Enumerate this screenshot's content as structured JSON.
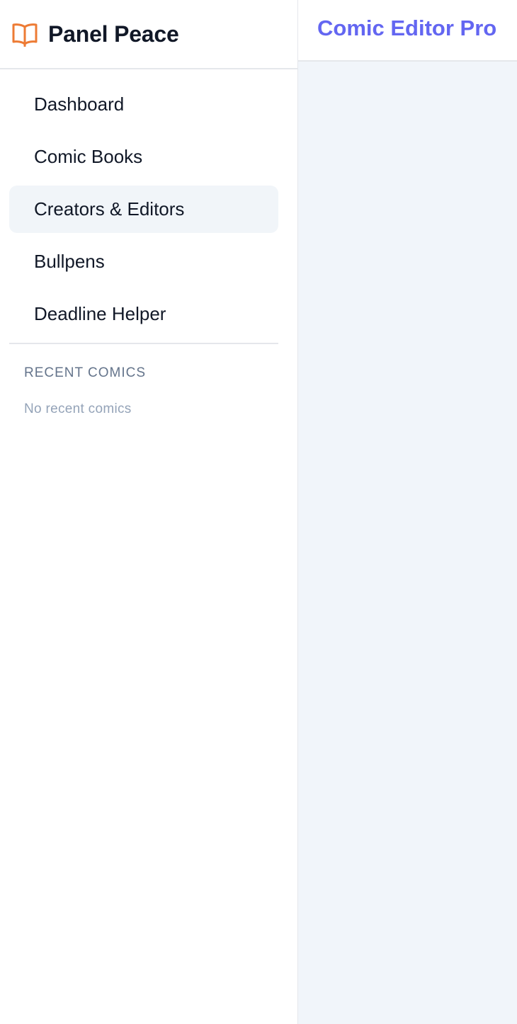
{
  "brand": {
    "name": "Panel Peace",
    "icon": "open-book-icon",
    "accent_color": "#ed7b34"
  },
  "nav": {
    "items": [
      {
        "label": "Dashboard",
        "active": false
      },
      {
        "label": "Comic Books",
        "active": false
      },
      {
        "label": "Creators & Editors",
        "active": true
      },
      {
        "label": "Bullpens",
        "active": false
      },
      {
        "label": "Deadline Helper",
        "active": false
      }
    ]
  },
  "recent": {
    "header": "RECENT COMICS",
    "empty_text": "No recent comics"
  },
  "topbar": {
    "title": "Comic Editor Pro",
    "title_color": "#6366f1"
  }
}
